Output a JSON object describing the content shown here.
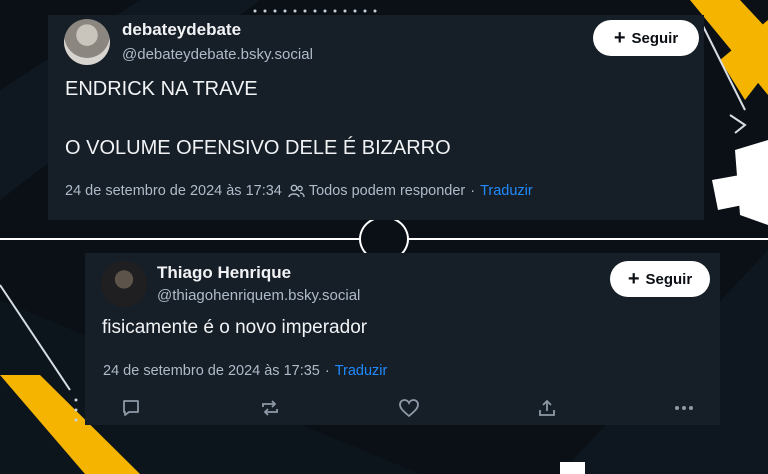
{
  "colors": {
    "background": "#0a1016",
    "card": "#161e27",
    "accent_yellow": "#f4b400",
    "link_blue": "#208bfe",
    "muted_text": "#aebbc9"
  },
  "posts": [
    {
      "author_name": "debateydebate",
      "handle": "@debateydebate.bsky.social",
      "follow_label": "Seguir",
      "text_lines": [
        "ENDRICK NA TRAVE",
        "O VOLUME OFENSIVO DELE É BIZARRO"
      ],
      "timestamp": "24 de setembro de 2024 às 17:34",
      "reply_setting": "Todos podem responder",
      "separator": "·",
      "translate_label": "Traduzir"
    },
    {
      "author_name": "Thiago Henrique",
      "handle": "@thiagohenriquem.bsky.social",
      "follow_label": "Seguir",
      "text_lines": [
        "fisicamente é o novo imperador"
      ],
      "timestamp": "24 de setembro de 2024 às 17:35",
      "separator": "·",
      "translate_label": "Traduzir",
      "actions": [
        "reply-icon",
        "repost-icon",
        "like-icon",
        "share-icon",
        "more-icon"
      ]
    }
  ]
}
